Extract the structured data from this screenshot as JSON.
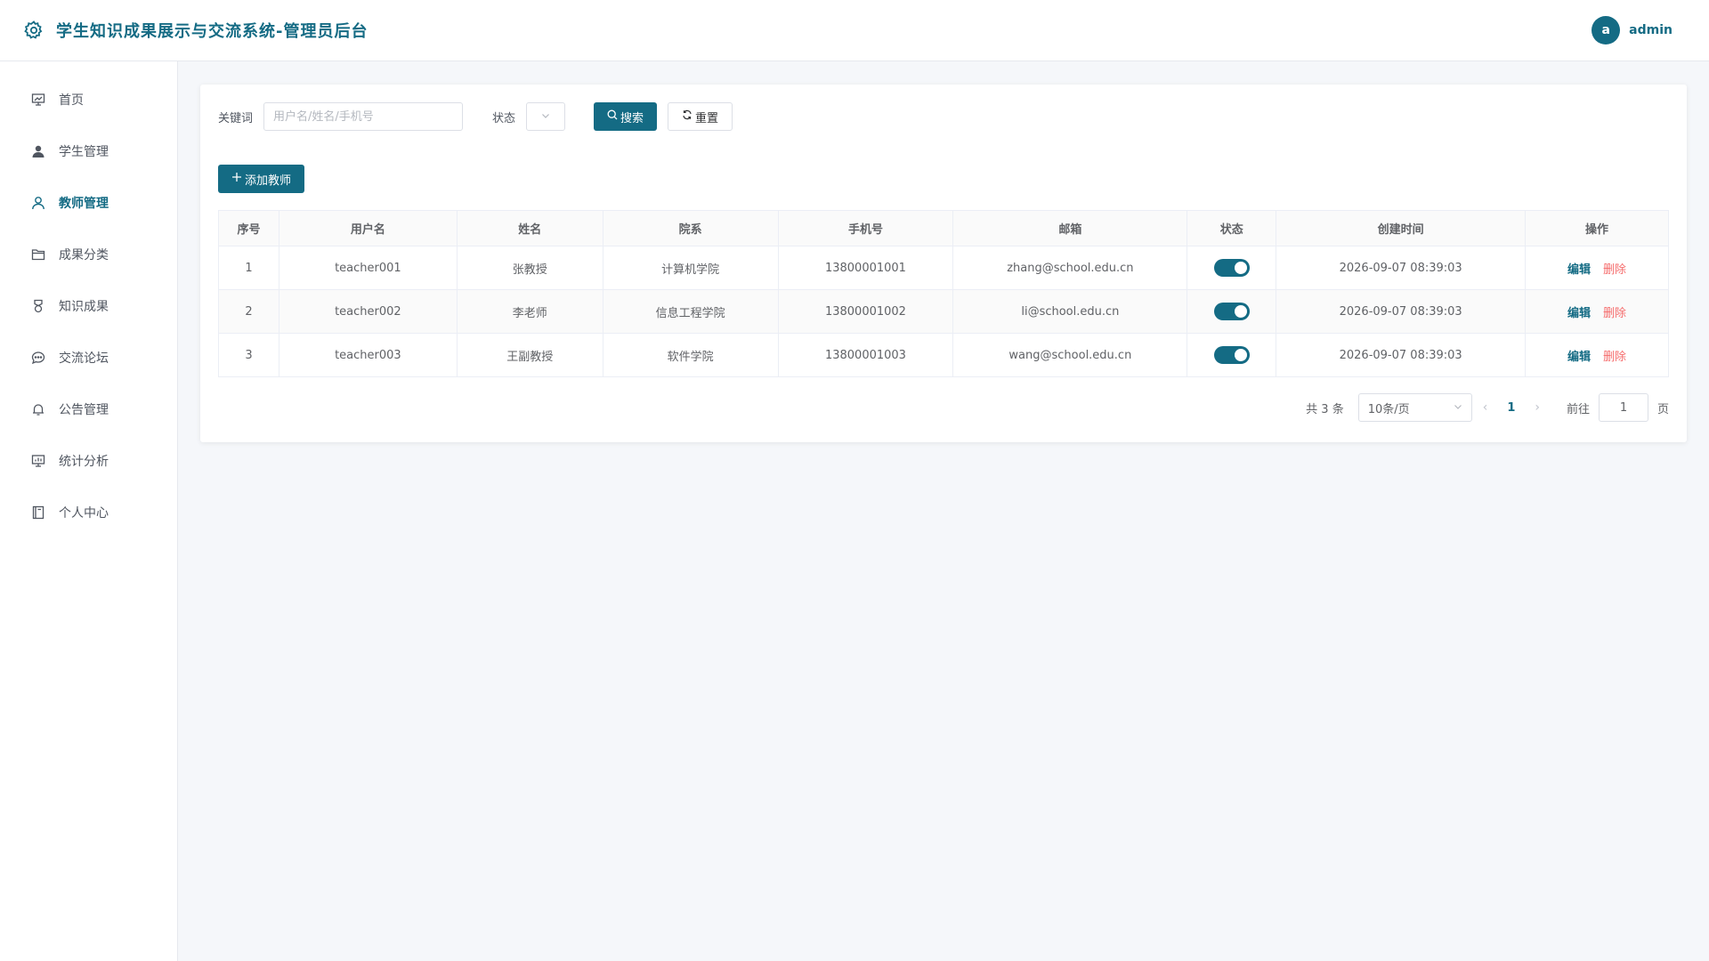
{
  "header": {
    "title": "学生知识成果展示与交流系统-管理员后台",
    "avatar_letter": "a",
    "username": "admin"
  },
  "sidebar": {
    "items": [
      {
        "label": "首页",
        "icon": "presentation-icon"
      },
      {
        "label": "学生管理",
        "icon": "user-filled-icon"
      },
      {
        "label": "教师管理",
        "icon": "user-icon",
        "active": true
      },
      {
        "label": "成果分类",
        "icon": "folder-icon"
      },
      {
        "label": "知识成果",
        "icon": "medal-icon"
      },
      {
        "label": "交流论坛",
        "icon": "chat-icon"
      },
      {
        "label": "公告管理",
        "icon": "bell-icon"
      },
      {
        "label": "统计分析",
        "icon": "chart-board-icon"
      },
      {
        "label": "个人中心",
        "icon": "notebook-icon"
      }
    ]
  },
  "filters": {
    "keyword_label": "关键词",
    "keyword_placeholder": "用户名/姓名/手机号",
    "status_label": "状态",
    "search_label": "搜索",
    "reset_label": "重置"
  },
  "actions": {
    "add_label": "添加教师"
  },
  "table": {
    "headers": [
      "序号",
      "用户名",
      "姓名",
      "院系",
      "手机号",
      "邮箱",
      "状态",
      "创建时间",
      "操作"
    ],
    "rows": [
      {
        "index": "1",
        "username": "teacher001",
        "name": "张教授",
        "dept": "计算机学院",
        "phone": "13800001001",
        "email": "zhang@school.edu.cn",
        "status": "on",
        "created": "2026-09-07 08:39:03"
      },
      {
        "index": "2",
        "username": "teacher002",
        "name": "李老师",
        "dept": "信息工程学院",
        "phone": "13800001002",
        "email": "li@school.edu.cn",
        "status": "on",
        "created": "2026-09-07 08:39:03"
      },
      {
        "index": "3",
        "username": "teacher003",
        "name": "王副教授",
        "dept": "软件学院",
        "phone": "13800001003",
        "email": "wang@school.edu.cn",
        "status": "on",
        "created": "2026-09-07 08:39:03"
      }
    ],
    "edit_label": "编辑",
    "delete_label": "删除"
  },
  "pagination": {
    "total_text": "共 3 条",
    "page_size": "10条/页",
    "current_page": "1",
    "goto_label": "前往",
    "goto_value": "1",
    "page_suffix": "页"
  },
  "colors": {
    "primary": "#146b84",
    "danger": "#f56c6c"
  }
}
